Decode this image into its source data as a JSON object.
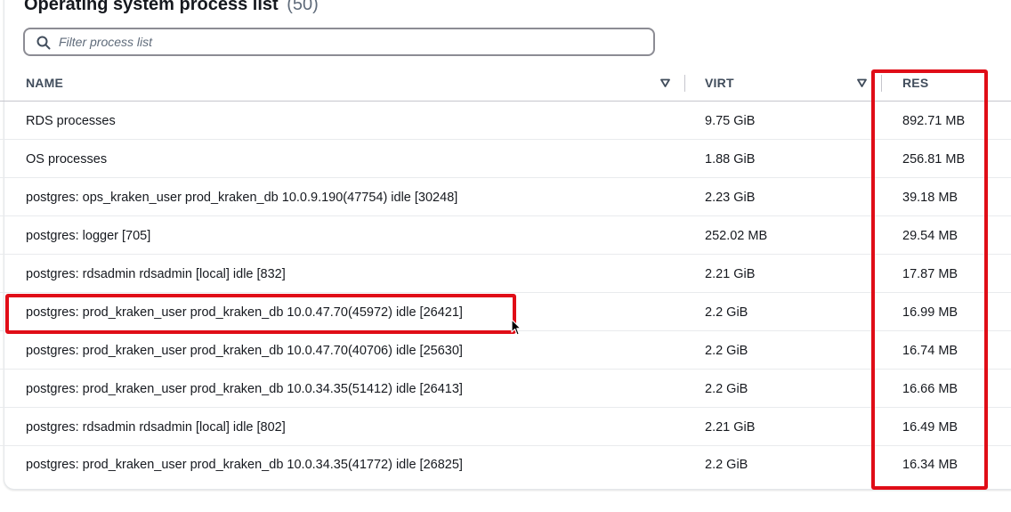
{
  "title": {
    "text": "Operating system process list",
    "count": "(50)"
  },
  "filter": {
    "placeholder": "Filter process list",
    "value": ""
  },
  "columns": {
    "name": "NAME",
    "virt": "VIRT",
    "res": "RES"
  },
  "rows": [
    {
      "name": "RDS processes",
      "virt": "9.75 GiB",
      "res": "892.71 MB"
    },
    {
      "name": "OS processes",
      "virt": "1.88 GiB",
      "res": "256.81 MB"
    },
    {
      "name": "postgres: ops_kraken_user prod_kraken_db 10.0.9.190(47754) idle [30248]",
      "virt": "2.23 GiB",
      "res": "39.18 MB"
    },
    {
      "name": "postgres: logger [705]",
      "virt": "252.02 MB",
      "res": "29.54 MB"
    },
    {
      "name": "postgres: rdsadmin rdsadmin [local] idle [832]",
      "virt": "2.21 GiB",
      "res": "17.87 MB"
    },
    {
      "name": "postgres: prod_kraken_user prod_kraken_db 10.0.47.70(45972) idle [26421]",
      "virt": "2.2 GiB",
      "res": "16.99 MB"
    },
    {
      "name": "postgres: prod_kraken_user prod_kraken_db 10.0.47.70(40706) idle [25630]",
      "virt": "2.2 GiB",
      "res": "16.74 MB"
    },
    {
      "name": "postgres: prod_kraken_user prod_kraken_db 10.0.34.35(51412) idle [26413]",
      "virt": "2.2 GiB",
      "res": "16.66 MB"
    },
    {
      "name": "postgres: rdsadmin rdsadmin [local] idle [802]",
      "virt": "2.21 GiB",
      "res": "16.49 MB"
    },
    {
      "name": "postgres: prod_kraken_user prod_kraken_db 10.0.34.35(41772) idle [26825]",
      "virt": "2.2 GiB",
      "res": "16.34 MB"
    }
  ],
  "colors": {
    "highlight": "#e00d17",
    "text": "#16191f",
    "header_text": "#414d5c"
  },
  "icons": {
    "search": "search-icon",
    "sort": "sort-triangle-icon",
    "cursor": "mouse-pointer-icon"
  }
}
